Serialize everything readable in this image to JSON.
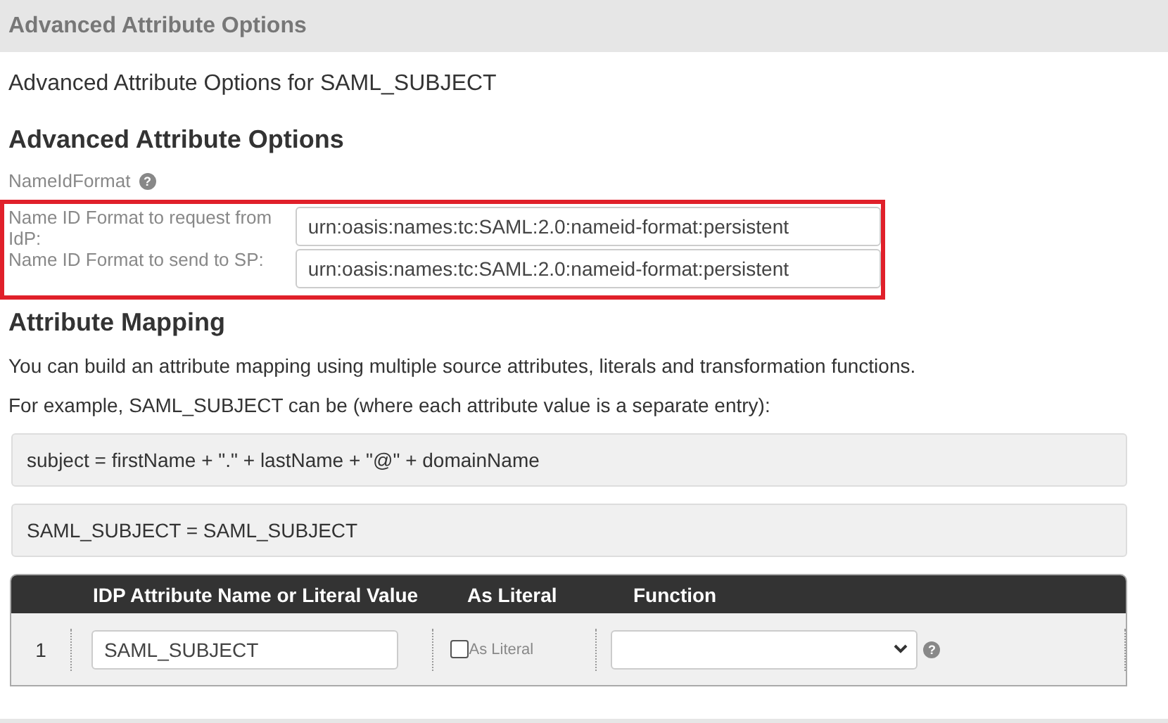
{
  "header": {
    "title": "Advanced Attribute Options"
  },
  "subtitle": "Advanced Attribute Options for SAML_SUBJECT",
  "section_title": "Advanced Attribute Options",
  "nameid_format": {
    "label": "NameIdFormat",
    "help_icon": "?",
    "fields": [
      {
        "label": "Name ID Format to request from IdP:",
        "value": "urn:oasis:names:tc:SAML:2.0:nameid-format:persistent"
      },
      {
        "label": "Name ID Format to send to SP:",
        "value": "urn:oasis:names:tc:SAML:2.0:nameid-format:persistent"
      }
    ]
  },
  "mapping": {
    "title": "Attribute Mapping",
    "paragraphs": [
      "You can build an attribute mapping using multiple source attributes, literals and transformation functions.",
      "For example, SAML_SUBJECT can be (where each attribute value is a separate entry):"
    ],
    "examples": [
      "subject = firstName + \".\" + lastName + \"@\" + domainName",
      "SAML_SUBJECT = SAML_SUBJECT"
    ],
    "table": {
      "columns": [
        "IDP Attribute Name or Literal Value",
        "As Literal",
        "Function"
      ],
      "rows": [
        {
          "index": "1",
          "value": "SAML_SUBJECT",
          "literal_label": "As Literal",
          "checked": false,
          "help_icon": "?"
        }
      ]
    }
  }
}
